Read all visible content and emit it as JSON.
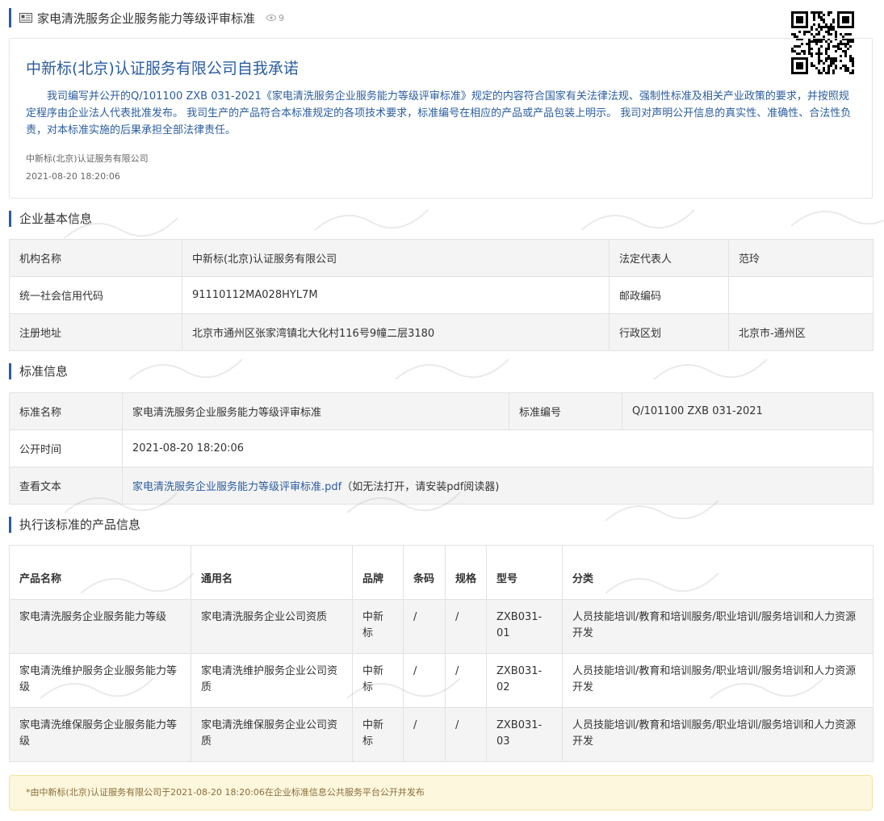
{
  "header": {
    "title": "家电清洗服务企业服务能力等级评审标准",
    "views": "9"
  },
  "promise": {
    "title": "中新标(北京)认证服务有限公司自我承诺",
    "body": "我司编写并公开的Q/101100 ZXB 031-2021《家电清洗服务企业服务能力等级评审标准》规定的内容符合国家有关法律法规、强制性标准及相关产业政策的要求，并按照规定程序由企业法人代表批准发布。 我司生产的产品符合本标准规定的各项技术要求，标准编号在相应的产品或产品包装上明示。 我司对声明公开信息的真实性、准确性、合法性负责，对本标准实施的后果承担全部法律责任。",
    "org": "中新标(北京)认证服务有限公司",
    "time": "2021-08-20 18:20:06"
  },
  "company": {
    "section_title": "企业基本信息",
    "name_label": "机构名称",
    "name_value": "中新标(北京)认证服务有限公司",
    "rep_label": "法定代表人",
    "rep_value": "范玲",
    "credit_label": "统一社会信用代码",
    "credit_value": "91110112MA028HYL7M",
    "postal_label": "邮政编码",
    "postal_value": "",
    "address_label": "注册地址",
    "address_value": "北京市通州区张家湾镇北大化村116号9幢二层3180",
    "region_label": "行政区划",
    "region_value": "北京市-通州区"
  },
  "standard": {
    "section_title": "标准信息",
    "name_label": "标准名称",
    "name_value": "家电清洗服务企业服务能力等级评审标准",
    "code_label": "标准编号",
    "code_value": "Q/101100 ZXB 031-2021",
    "time_label": "公开时间",
    "time_value": "2021-08-20 18:20:06",
    "text_label": "查看文本",
    "file_link": "家电清洗服务企业服务能力等级评审标准.pdf",
    "file_note": "（如无法打开，请安装pdf阅读器)"
  },
  "products": {
    "section_title": "执行该标准的产品信息",
    "headers": [
      "产品名称",
      "通用名",
      "品牌",
      "条码",
      "规格",
      "型号",
      "分类"
    ],
    "rows": [
      [
        "家电清洗服务企业服务能力等级",
        "家电清洗服务企业公司资质",
        "中新标",
        "/",
        "/",
        "ZXB031-01",
        "人员技能培训/教育和培训服务/职业培训/服务培训和人力资源开发"
      ],
      [
        "家电清洗维护服务企业服务能力等级",
        "家电清洗维护服务企业公司资质",
        "中新标",
        "/",
        "/",
        "ZXB031-02",
        "人员技能培训/教育和培训服务/职业培训/服务培训和人力资源开发"
      ],
      [
        "家电清洗维保服务企业服务能力等级",
        "家电清洗维保服务企业公司资质",
        "中新标",
        "/",
        "/",
        "ZXB031-03",
        "人员技能培训/教育和培训服务/职业培训/服务培训和人力资源开发"
      ]
    ]
  },
  "footer": {
    "text": "*由中新标(北京)认证服务有限公司于2021-08-20 18:20:06在企业标准信息公共服务平台公开并发布"
  }
}
